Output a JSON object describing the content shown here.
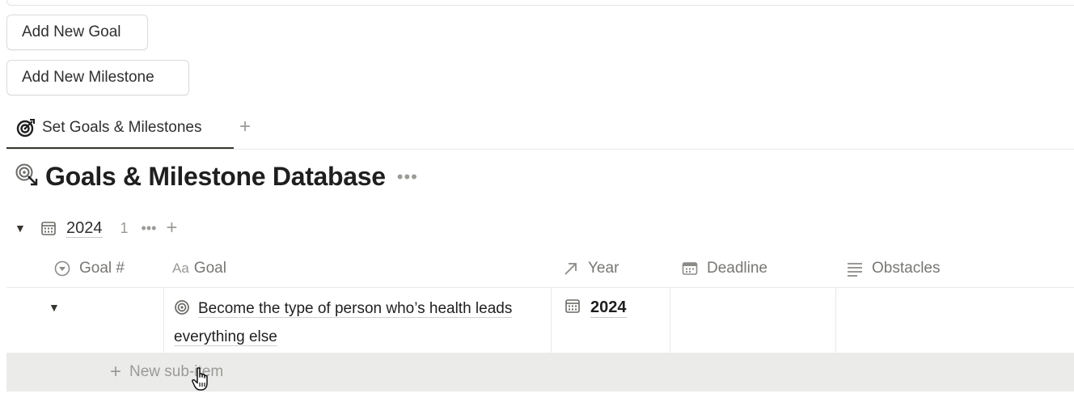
{
  "buttons": {
    "add_goal": "Add New Goal",
    "add_milestone": "Add New Milestone"
  },
  "tabs": [
    {
      "label": "Set Goals & Milestones",
      "icon": "target-icon"
    }
  ],
  "tab_add": "+",
  "database": {
    "title": "Goals & Milestone Database",
    "more": "•••"
  },
  "group": {
    "toggle": "▼",
    "label": "2024",
    "count": "1",
    "more": "•••",
    "add": "+"
  },
  "columns": [
    {
      "label": "Goal #",
      "icon": "status-icon"
    },
    {
      "label": "Goal",
      "icon": "text-type-icon",
      "icon_text": "Aa"
    },
    {
      "label": "Year",
      "icon": "relation-arrow-icon"
    },
    {
      "label": "Deadline",
      "icon": "calendar-icon"
    },
    {
      "label": "Obstacles",
      "icon": "lines-icon"
    }
  ],
  "rows": [
    {
      "toggle": "▼",
      "goal": "Become the type of person who’s health leads everything else",
      "year": "2024"
    }
  ],
  "new_sub_item": {
    "plus": "+",
    "label": "New sub-item"
  }
}
